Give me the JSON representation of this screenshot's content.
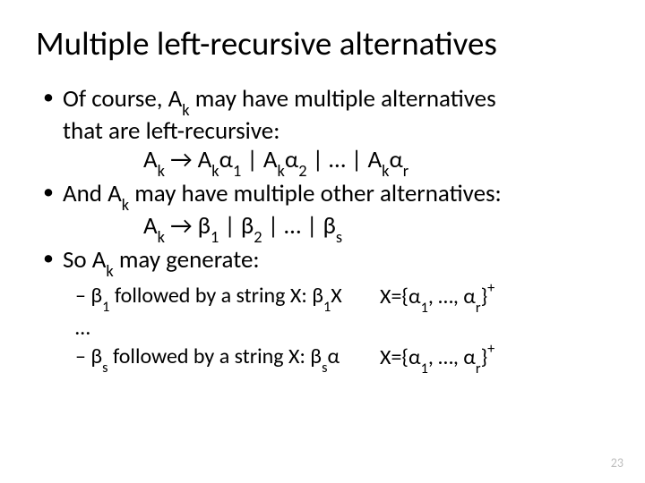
{
  "title": "Multiple left-recursive alternatives",
  "bullet1": {
    "line1_a": "Of course, A",
    "line1_sub": "k",
    "line1_b": " may have multiple alternatives",
    "line2": "that are left-recursive:",
    "prod_a": "A",
    "prod_ksub": "k",
    "prod_arrow": " → A",
    "prod_ksub2": "k",
    "prod_alpha": "α",
    "prod_s1": "1",
    "prod_p1": " | A",
    "prod_ksub3": "k",
    "prod_alpha2": "α",
    "prod_s2": "2",
    "prod_p2": " | … | A",
    "prod_ksub4": "k",
    "prod_alpha3": "α",
    "prod_sr": "r"
  },
  "bullet2": {
    "line1_a": " And A",
    "line1_sub": "k",
    "line1_b": " may have multiple other alternatives:",
    "prod_a": "A",
    "prod_ksub": "k",
    "prod_arrow": " → β",
    "prod_s1": "1",
    "prod_p1": " | β",
    "prod_s2": "2",
    "prod_p2": " | … | β",
    "prod_ss": "s"
  },
  "bullet3": {
    "line_a": "So A",
    "line_sub": "k",
    "line_b": " may generate:"
  },
  "dash1": {
    "left_a": "– β",
    "left_s1": "1",
    "left_b": " followed by a string X: β",
    "left_s1b": "1",
    "left_c": "X",
    "right_a": "X={α",
    "right_s1": "1",
    "right_b": ", …, α",
    "right_sr": "r",
    "right_c": "}",
    "right_sup": "+"
  },
  "dash_mid": "…",
  "dash2": {
    "left_a": "– β",
    "left_ss": "s",
    "left_b": " followed by a string X: β",
    "left_ssb": "s",
    "left_c": "α",
    "right_a": "X={α",
    "right_s1": "1",
    "right_b": ", …, α",
    "right_sr": "r",
    "right_c": "}",
    "right_sup": "+"
  },
  "page_number": "23"
}
